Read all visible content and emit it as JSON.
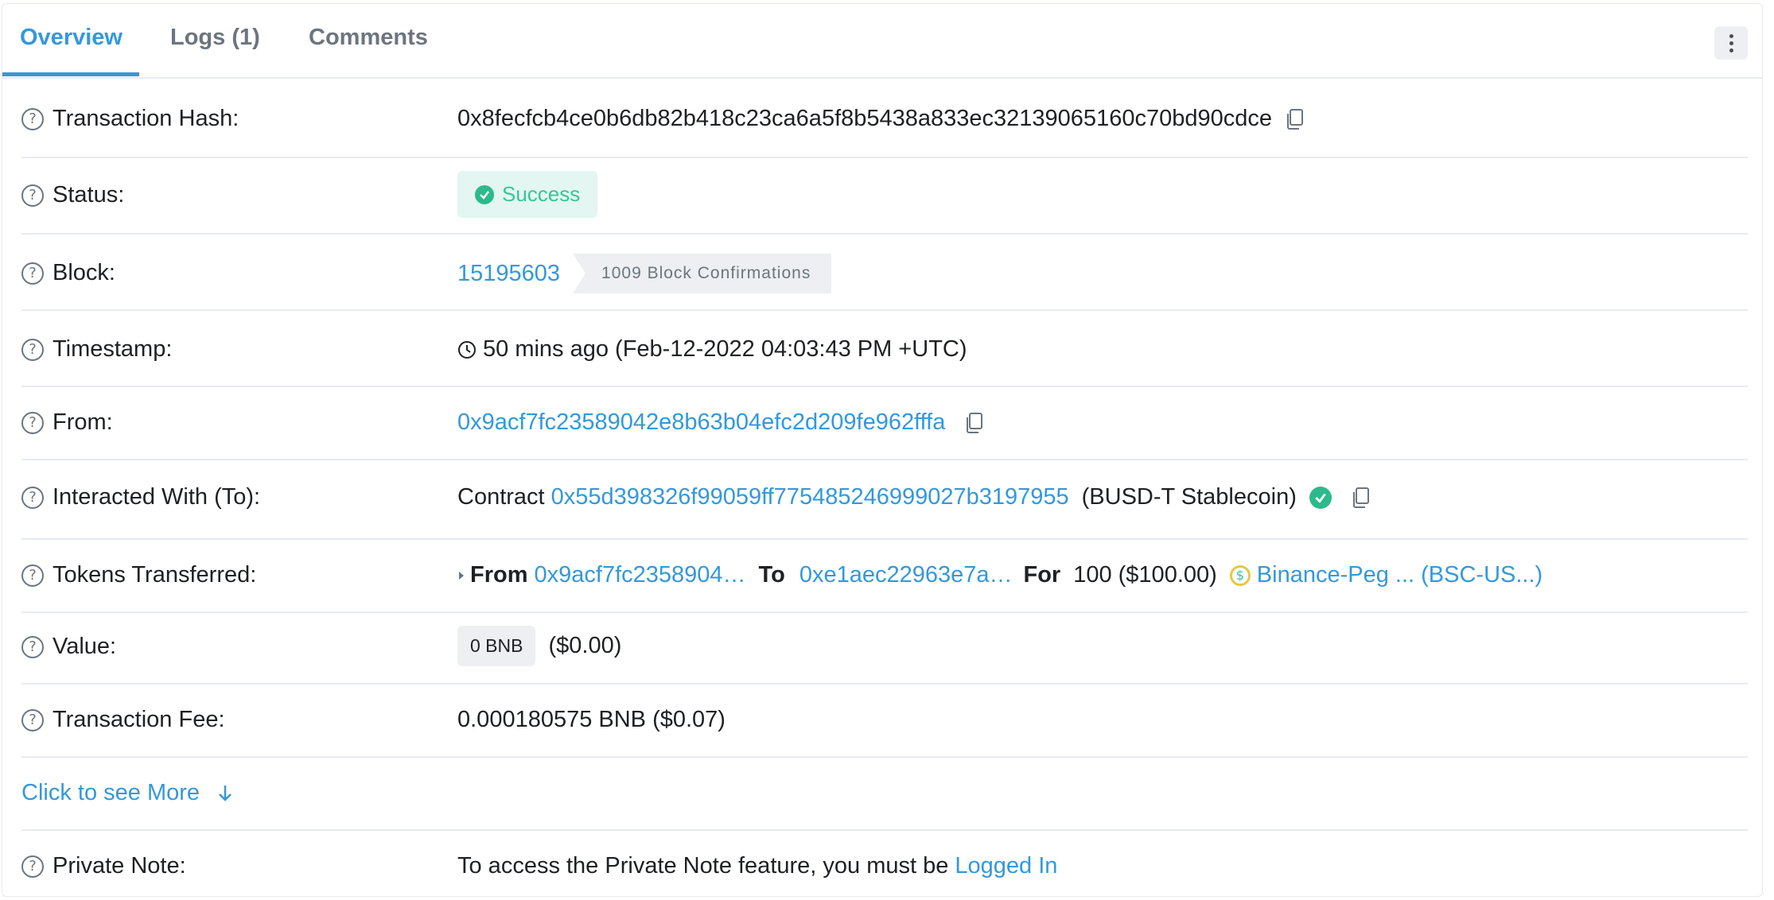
{
  "tabs": [
    "Overview",
    "Logs (1)",
    "Comments"
  ],
  "rows": {
    "tx_hash": {
      "label": "Transaction Hash:",
      "value": "0x8fecfcb4ce0b6db82b418c23ca6a5f8b5438a833ec32139065160c70bd90cdce"
    },
    "status": {
      "label": "Status:",
      "value": "Success"
    },
    "block": {
      "label": "Block:",
      "number": "15195603",
      "confirmations": "1009 Block Confirmations"
    },
    "timestamp": {
      "label": "Timestamp:",
      "value": "50 mins ago (Feb-12-2022 04:03:43 PM +UTC)"
    },
    "from": {
      "label": "From:",
      "address": "0x9acf7fc23589042e8b63b04efc2d209fe962fffa"
    },
    "to": {
      "label": "Interacted With (To):",
      "prefix": "Contract",
      "address": "0x55d398326f99059ff775485246999027b3197955",
      "name": "(BUSD-T Stablecoin)"
    },
    "tokens": {
      "label": "Tokens Transferred:",
      "from_label": "From",
      "from_address": "0x9acf7fc2358904…",
      "to_label": "To",
      "to_address": "0xe1aec22963e7a…",
      "for_label": "For",
      "amount": "100 ($100.00)",
      "token_name": "Binance-Peg ... (BSC-US...)"
    },
    "value": {
      "label": "Value:",
      "amount": "0 BNB",
      "usd": "($0.00)"
    },
    "fee": {
      "label": "Transaction Fee:",
      "value": "0.000180575 BNB ($0.07)"
    },
    "private_note": {
      "label": "Private Note:",
      "text": "To access the Private Note feature, you must be",
      "link": "Logged In"
    }
  },
  "see_more": "Click to see More",
  "colors": {
    "accent": "#3498db",
    "success": "#38c49a",
    "border": "#e7eaf3"
  }
}
